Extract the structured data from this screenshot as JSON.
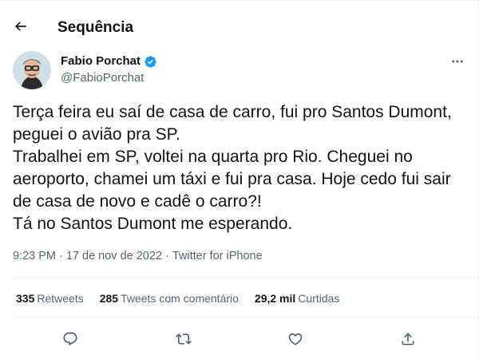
{
  "header": {
    "title": "Sequência",
    "back_icon": "arrow-left-icon"
  },
  "author": {
    "name": "Fabio Porchat",
    "handle": "@FabioPorchat",
    "verified": true,
    "verified_color": "#1d9bf0"
  },
  "tweet": {
    "text": "Terça feira eu saí de casa de carro, fui pro Santos Dumont, peguei o avião pra SP.\nTrabalhei em SP, voltei na quarta pro Rio. Cheguei no aeroporto, chamei um táxi e fui pra casa. Hoje cedo fui sair de casa de novo e cadê o carro?!\nTá no Santos Dumont me esperando.",
    "time": "9:23 PM",
    "date": "17 de nov de 2022",
    "separator": "·",
    "source": "Twitter for iPhone"
  },
  "stats": {
    "retweets_count": "335",
    "retweets_label": "Retweets",
    "quotes_count": "285",
    "quotes_label": "Tweets com comentário",
    "likes_count": "29,2 mil",
    "likes_label": "Curtidas"
  },
  "actions": {
    "reply_icon": "reply-icon",
    "retweet_icon": "retweet-icon",
    "like_icon": "heart-icon",
    "share_icon": "share-icon"
  },
  "colors": {
    "text": "#0f1419",
    "secondary": "#536471",
    "divider": "#eff3f4"
  }
}
